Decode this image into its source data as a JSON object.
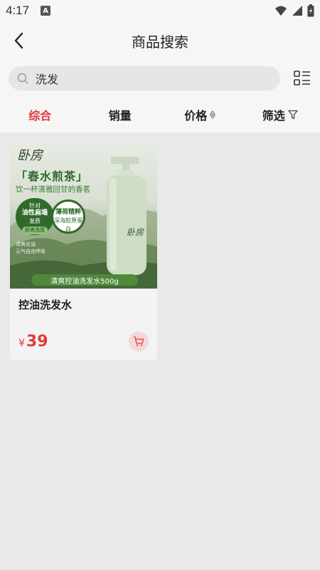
{
  "status_bar": {
    "time": "4:17",
    "notification_letter": "A",
    "icons": [
      "wifi-icon",
      "signal-icon",
      "battery-icon"
    ]
  },
  "header": {
    "title": "商品搜索",
    "back_icon": "chevron-left-icon"
  },
  "search": {
    "value": "洗发",
    "icon": "search-icon",
    "layout_toggle_icon": "list-layout-icon"
  },
  "sort_tabs": [
    {
      "label": "综合",
      "active": true
    },
    {
      "label": "销量",
      "active": false
    },
    {
      "label": "价格",
      "active": false,
      "icon": "sort-updown-icon"
    },
    {
      "label": "筛选",
      "active": false,
      "icon": "filter-icon"
    }
  ],
  "products": [
    {
      "name": "控油洗发水",
      "currency": "¥",
      "price": "39",
      "cart_icon": "cart-icon",
      "image": {
        "brand": "卧房",
        "headline": "「春水煎茶」",
        "subline": "饮一杯清雅回甘的香茗",
        "badge_oil": [
          "针对",
          "油性扁塌",
          "发质",
          "舒爽洗感"
        ],
        "badge_mint": [
          "薄荷精粹",
          "深海胶原蛋白"
        ],
        "tagline": [
          "清爽去油",
          "元气自由呼吸"
        ],
        "banner": "清爽控油洗发水500g"
      }
    }
  ],
  "colors": {
    "accent": "#e33a3c",
    "page_bg": "#e9e9e9",
    "header_bg": "#f6f6f6",
    "cart_bg": "#f5d7d8"
  }
}
